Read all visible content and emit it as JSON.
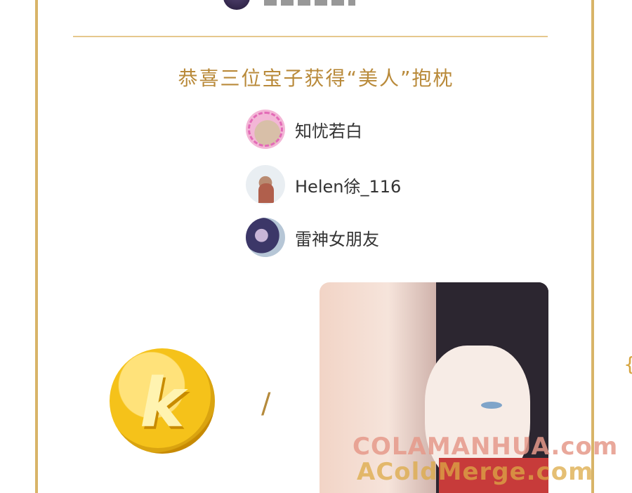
{
  "header": {
    "title": "恭喜三位宝子获得“美人”抱枕"
  },
  "winners": [
    {
      "name": "知忧若白"
    },
    {
      "name": "Helen徐_116"
    },
    {
      "name": "雷神女朋友"
    }
  ],
  "prize": {
    "coin_label": "k",
    "separator": "/"
  },
  "watermark": {
    "line1": "COLAMANHUA.com",
    "line2": "AColdMerge.com"
  },
  "edge_char": "{",
  "colors": {
    "frame": "#d8b468",
    "title": "#b98a3a",
    "coin": "#f5c21a"
  },
  "icons": [
    "coin-icon",
    "pillow-image"
  ]
}
